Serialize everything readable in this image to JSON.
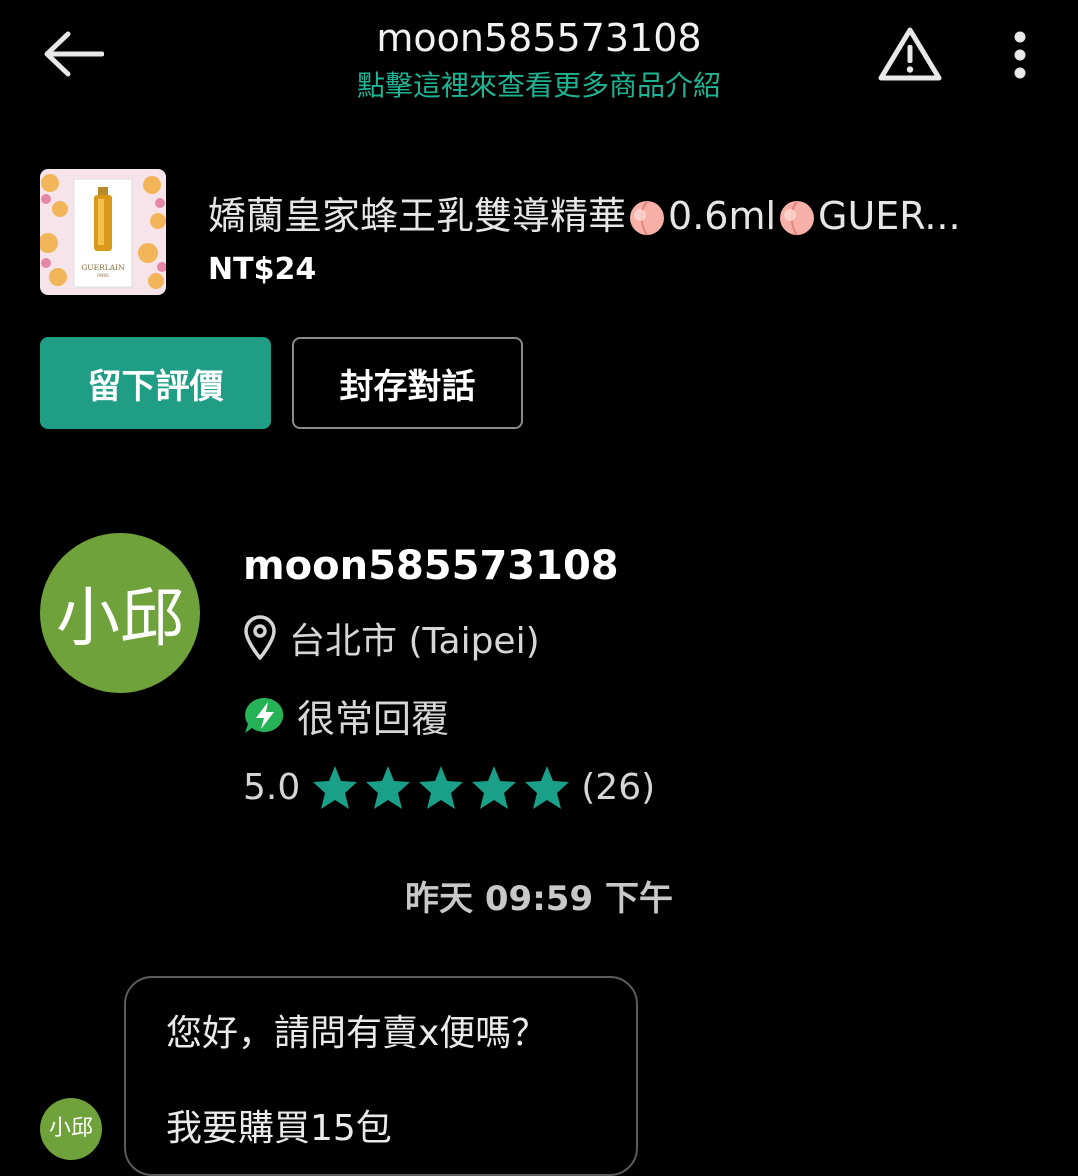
{
  "header": {
    "title": "moon585573108",
    "subtitle": "點擊這裡來查看更多商品介紹",
    "icons": {
      "back": "back-arrow-icon",
      "report": "warning-icon",
      "more": "more-vertical-icon"
    }
  },
  "product": {
    "name_part1": "嬌蘭皇家蜂王乳雙導精華",
    "name_part2": "0.6ml",
    "name_part3": "GUER...",
    "emoji": "peach-icon",
    "price": "NT$24",
    "thumb_brand": "GUERLAIN",
    "thumb_sub": "PARIS"
  },
  "actions": {
    "review_label": "留下評價",
    "archive_label": "封存對話"
  },
  "seller": {
    "avatar_text": "小邱",
    "name": "moon585573108",
    "location": "台北市 (Taipei)",
    "response": "很常回覆",
    "rating": "5.0",
    "stars": 5,
    "review_count": "(26)"
  },
  "chat": {
    "timestamp": "昨天 09:59 下午",
    "messages": [
      "您好，請問有賣x便嗎？",
      "我要購買15包"
    ],
    "avatar_small_text": "小邱"
  },
  "colors": {
    "accent": "#1fb394",
    "button_fill": "#1f9e85",
    "avatar": "#6fa23a",
    "star": "#1aa088",
    "response_badge": "#26b357"
  }
}
